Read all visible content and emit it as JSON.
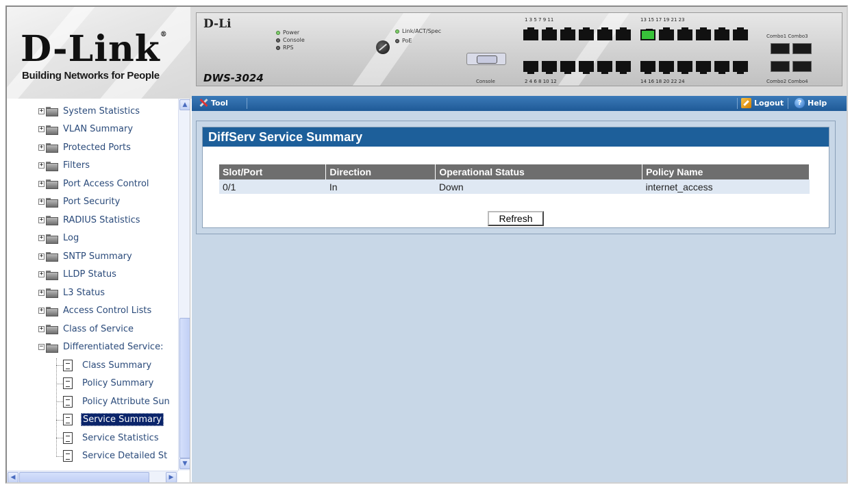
{
  "brand": {
    "name": "D-Link",
    "tagline": "Building Networks for People",
    "registered_mark": "®"
  },
  "device": {
    "brand": "D-Li",
    "model": "DWS-3024",
    "leds": [
      "Power",
      "Console",
      "RPS"
    ],
    "leds_right": [
      "Link/ACT/Spec",
      "PoE"
    ],
    "console_label": "Console",
    "ports_top_a": "1   3   5   7   9   11",
    "ports_top_b": "13   15   17   19   21   23",
    "ports_bot_a": "2   4   6   8   10   12",
    "ports_bot_b": "14   16   18   20   22   24",
    "combo_top": "Combo1 Combo3",
    "combo_bot": "Combo2 Combo4"
  },
  "toolbar": {
    "tool_label": "Tool",
    "logout_label": "Logout",
    "help_label": "Help"
  },
  "sidebar": {
    "folders": [
      "System Statistics",
      "VLAN Summary",
      "Protected Ports",
      "Filters",
      "Port Access Control",
      "Port Security",
      "RADIUS Statistics",
      "Log",
      "SNTP Summary",
      "LLDP Status",
      "L3 Status",
      "Access Control Lists",
      "Class of Service",
      "Differentiated Service:"
    ],
    "leaves": [
      "Class Summary",
      "Policy Summary",
      "Policy Attribute Sun",
      "Service Summary",
      "Service Statistics",
      "Service Detailed St"
    ],
    "selected": "Service Summary"
  },
  "main": {
    "title": "DiffServ Service Summary",
    "table": {
      "headers": [
        "Slot/Port",
        "Direction",
        "Operational Status",
        "Policy Name"
      ],
      "rows": [
        [
          "0/1",
          "In",
          "Down",
          "internet_access"
        ]
      ]
    },
    "refresh_label": "Refresh"
  },
  "colors": {
    "toolbar_blue": "#1f5a97",
    "panel_title_blue": "#1d5f9a",
    "content_bg": "#c8d7e7",
    "selection": "#0a246a"
  }
}
